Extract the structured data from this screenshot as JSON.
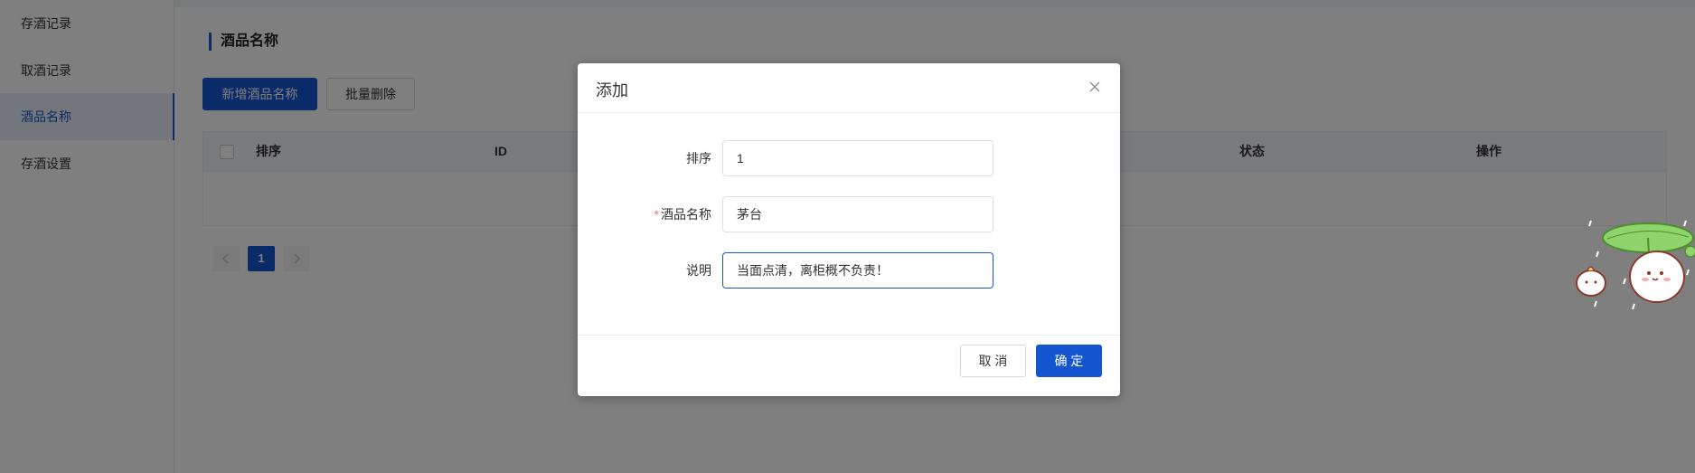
{
  "sidebar": {
    "items": [
      {
        "label": "存酒记录",
        "active": false
      },
      {
        "label": "取酒记录",
        "active": false
      },
      {
        "label": "酒品名称",
        "active": true
      },
      {
        "label": "存酒设置",
        "active": false
      }
    ]
  },
  "main": {
    "title": "酒品名称",
    "add_button": "新增酒品名称",
    "batch_delete_button": "批量删除",
    "table": {
      "columns": [
        "排序",
        "ID",
        "状态",
        "操作"
      ]
    },
    "pagination": {
      "current_page": "1"
    }
  },
  "modal": {
    "title": "添加",
    "fields": {
      "sort": {
        "label": "排序",
        "value": "1"
      },
      "name": {
        "label": "酒品名称",
        "required_mark": "*",
        "value": "茅台"
      },
      "desc": {
        "label": "说明",
        "value": "当面点清，离柜概不负责！"
      }
    },
    "cancel_label": "取 消",
    "confirm_label": "确 定"
  },
  "colors": {
    "primary": "#1556d0",
    "overlay": "rgba(0,0,0,0.5)",
    "required": "#f56c6c"
  }
}
